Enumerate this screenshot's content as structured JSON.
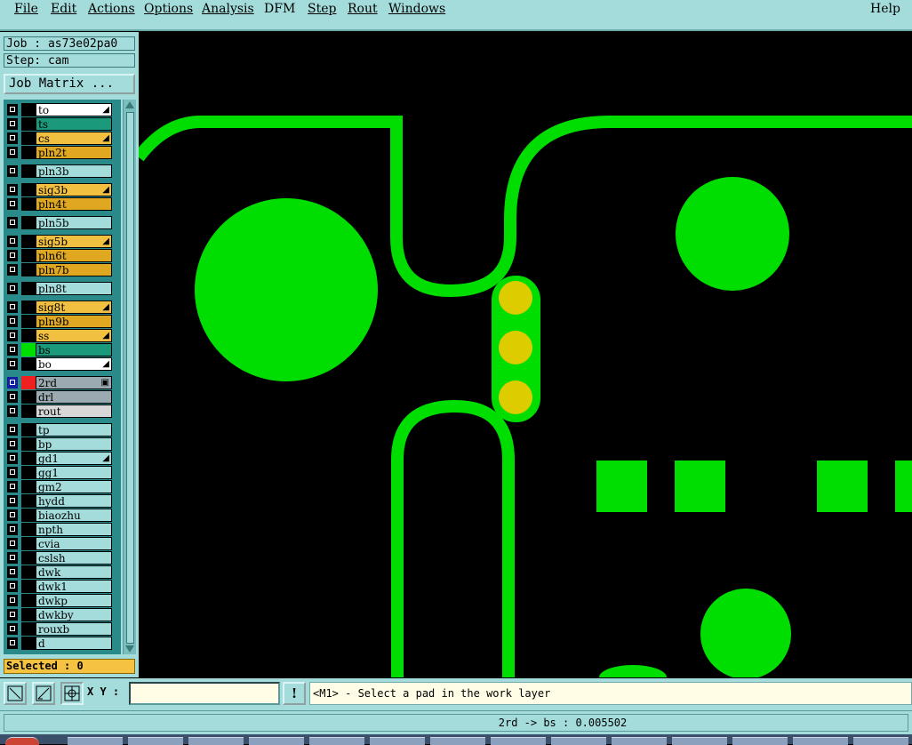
{
  "menubar": {
    "items": [
      {
        "label": "File",
        "key": "F"
      },
      {
        "label": "Edit",
        "key": "E"
      },
      {
        "label": "Actions",
        "key": "A"
      },
      {
        "label": "Options",
        "key": "O"
      },
      {
        "label": "Analysis",
        "key": "A"
      },
      {
        "label": "DFM",
        "key": ""
      },
      {
        "label": "Step",
        "key": "S"
      },
      {
        "label": "Rout",
        "key": "R"
      },
      {
        "label": "Windows",
        "key": "W"
      }
    ],
    "help": "Help"
  },
  "job": {
    "job_line": "Job : as73e02pa0",
    "step_line": "Step: cam",
    "matrix_button": "Job Matrix ..."
  },
  "layers": [
    {
      "name": "to",
      "bg": "#ffffff",
      "mark": true
    },
    {
      "name": "ts",
      "bg": "#1a9a7a",
      "mark": false
    },
    {
      "name": "cs",
      "bg": "#f2c040",
      "mark": true
    },
    {
      "name": "pln2t",
      "bg": "#e0a820",
      "mark": false
    },
    {
      "name": "pln3b",
      "bg": "#a4dcdc",
      "mark": false
    },
    {
      "name": "sig3b",
      "bg": "#f2c040",
      "mark": true
    },
    {
      "name": "pln4t",
      "bg": "#e0a820",
      "mark": false
    },
    {
      "name": "pln5b",
      "bg": "#a4dcdc",
      "mark": false
    },
    {
      "name": "sig5b",
      "bg": "#f2c040",
      "mark": true
    },
    {
      "name": "pln6t",
      "bg": "#e0a820",
      "mark": false
    },
    {
      "name": "pln7b",
      "bg": "#e0a820",
      "mark": false
    },
    {
      "name": "pln8t",
      "bg": "#a4dcdc",
      "mark": false
    },
    {
      "name": "sig8t",
      "bg": "#f2c040",
      "mark": true
    },
    {
      "name": "pln9b",
      "bg": "#e0a820",
      "mark": false
    },
    {
      "name": "ss",
      "bg": "#f2c040",
      "mark": true
    },
    {
      "name": "bs",
      "bg": "#1a9a7a",
      "mark": false
    },
    {
      "name": "bo",
      "bg": "#ffffff",
      "mark": true
    },
    {
      "name": "2rd",
      "bg": "#9aaab0",
      "mark": false
    },
    {
      "name": "drl",
      "bg": "#9aaab0",
      "mark": false
    },
    {
      "name": "rout",
      "bg": "#d8d8d8",
      "mark": false
    },
    {
      "name": "tp",
      "bg": "#a4dcdc",
      "mark": false
    },
    {
      "name": "bp",
      "bg": "#a4dcdc",
      "mark": false
    },
    {
      "name": "gd1",
      "bg": "#a4dcdc",
      "mark": true
    },
    {
      "name": "gg1",
      "bg": "#a4dcdc",
      "mark": false
    },
    {
      "name": "gm2",
      "bg": "#a4dcdc",
      "mark": false
    },
    {
      "name": "hydd",
      "bg": "#a4dcdc",
      "mark": false
    },
    {
      "name": "biaozhu",
      "bg": "#a4dcdc",
      "mark": false
    },
    {
      "name": "npth",
      "bg": "#a4dcdc",
      "mark": false
    },
    {
      "name": "cvia",
      "bg": "#a4dcdc",
      "mark": false
    },
    {
      "name": "cslsh",
      "bg": "#a4dcdc",
      "mark": false
    },
    {
      "name": "dwk",
      "bg": "#a4dcdc",
      "mark": false
    },
    {
      "name": "dwk1",
      "bg": "#a4dcdc",
      "mark": false
    },
    {
      "name": "dwkp",
      "bg": "#a4dcdc",
      "mark": false
    },
    {
      "name": "dwkby",
      "bg": "#a4dcdc",
      "mark": false
    },
    {
      "name": "rouxb",
      "bg": "#a4dcdc",
      "mark": false
    },
    {
      "name": "d",
      "bg": "#a4dcdc",
      "mark": false
    }
  ],
  "selected_text": "Selected : 0",
  "bottom": {
    "xy_label": "X Y :",
    "xy_value": "",
    "excl": "!",
    "prompt": "<M1> - Select a pad in the work layer"
  },
  "status": "2rd -> bs : 0.005502",
  "colors": {
    "copper": "#00dd00",
    "pad": "#ddcc00",
    "panel": "#a4dcdc"
  }
}
